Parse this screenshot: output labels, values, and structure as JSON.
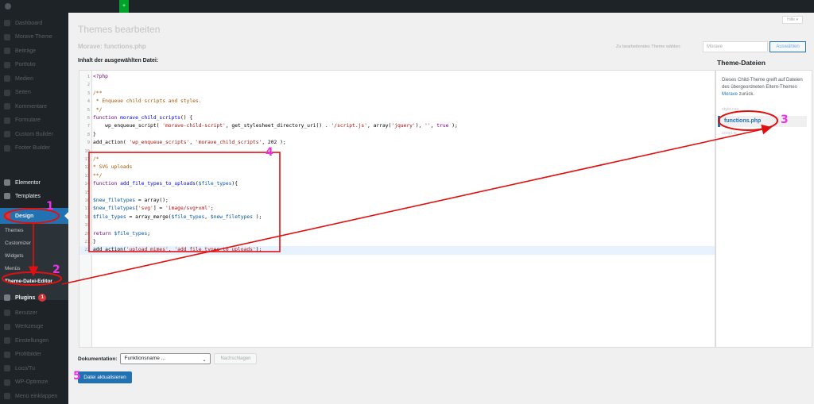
{
  "admin_bar": {
    "green_label": "+"
  },
  "menu": {
    "faded": [
      "Dashboard",
      "Morave Theme",
      "Beiträge",
      "Portfolio",
      "Medien",
      "Seiten",
      "Kommentare",
      "Formulare",
      "Custom Builder",
      "Footer Builder"
    ],
    "elementor": "Elementor",
    "templates": "Templates",
    "design": "Design",
    "submenu": [
      "Themes",
      "Customizer",
      "Widgets",
      "Menüs",
      "Theme-Datei-Editor"
    ],
    "plugins": "Plugins",
    "plugins_badge": "1",
    "faded_bottom": [
      "Benutzer",
      "Werkzeuge",
      "Einstellungen",
      "Profilbilder",
      "Loco/Tu",
      "WP-Optimize",
      "Menü einklappen"
    ]
  },
  "header": {
    "title": "Themes bearbeiten",
    "theme_name": "Morave: functions.php",
    "help": "Hilfe ▾",
    "select_theme_label": "Zu bearbeitendes Theme wählen:",
    "select_theme_value": "Morave",
    "select_button": "Auswählen"
  },
  "editor": {
    "label": "Inhalt der ausgewählten Datei:",
    "lines": [
      {
        "n": "1",
        "html": "<span class='kw'>&lt;?php</span>"
      },
      {
        "n": "2",
        "html": ""
      },
      {
        "n": "3",
        "html": "<span class='comment'>/**</span>"
      },
      {
        "n": "4",
        "html": "<span class='comment'> * Enqueue child scripts and styles.</span>"
      },
      {
        "n": "5",
        "html": "<span class='comment'> */</span>"
      },
      {
        "n": "6",
        "html": "<span class='kw'>function</span> <span class='def'>morave_child_scripts</span>() {"
      },
      {
        "n": "7",
        "html": "    wp_enqueue_script( <span class='str'>'morave-child-script'</span>, get_stylesheet_directory_uri() . <span class='str'>'/script.js'</span>, array(<span class='str'>'jquery'</span>), <span class='str'>''</span>, <span class='kw'>true</span> );"
      },
      {
        "n": "8",
        "html": "}"
      },
      {
        "n": "9",
        "html": "add_action( <span class='str'>'wp_enqueue_scripts'</span>, <span class='str'>'morave_child_scripts'</span>, 202 );"
      },
      {
        "n": "10",
        "html": ""
      },
      {
        "n": "11",
        "html": "<span class='comment'>/*</span>"
      },
      {
        "n": "12",
        "html": "<span class='comment'>* SVG uploads</span>"
      },
      {
        "n": "13",
        "html": "<span class='comment'>**/</span>"
      },
      {
        "n": "14",
        "html": "<span class='kw'>function</span> <span class='def'>add_file_types_to_uploads</span>(<span class='var'>$file_types</span>){"
      },
      {
        "n": "15",
        "html": ""
      },
      {
        "n": "16",
        "html": "<span class='var'>$new_filetypes</span> = array();"
      },
      {
        "n": "17",
        "html": "<span class='var'>$new_filetypes</span>[<span class='str'>'svg'</span>] = <span class='str'>'image/svg+xml'</span>;"
      },
      {
        "n": "18",
        "html": "<span class='var'>$file_types</span> = array_merge(<span class='var'>$file_types</span>, <span class='var'>$new_filetypes</span> );"
      },
      {
        "n": "19",
        "html": ""
      },
      {
        "n": "20",
        "html": "<span class='kw'>return</span> <span class='var'>$file_types</span>;"
      },
      {
        "n": "21",
        "html": "}"
      },
      {
        "n": "22",
        "html": "add_action(<span class='str'>'upload_mimes'</span>, <span class='str'>'add_file_types_to_uploads'</span>);"
      }
    ]
  },
  "theme_files": {
    "heading": "Theme-Dateien",
    "desc_pre": "Dieses Child-Theme greift auf Dateien des übergeordneten Eltern-Themes ",
    "desc_link": "Morave",
    "desc_post": " zurück.",
    "faded_top": "style.css",
    "active": "functions.php",
    "faded_bottom": "script.js"
  },
  "docs": {
    "label": "Dokumentation:",
    "select_value": "Funktionsname ...",
    "lookup_button": "Nachschlagen"
  },
  "submit": {
    "label": "Datei aktualisieren"
  },
  "annotations": {
    "n1": "1",
    "n2": "2",
    "n3": "3",
    "n4": "4",
    "n5": "5"
  },
  "colors": {
    "annotation_red": "#e01010",
    "annotation_number": "#e535e5",
    "wp_blue": "#2271b1"
  }
}
